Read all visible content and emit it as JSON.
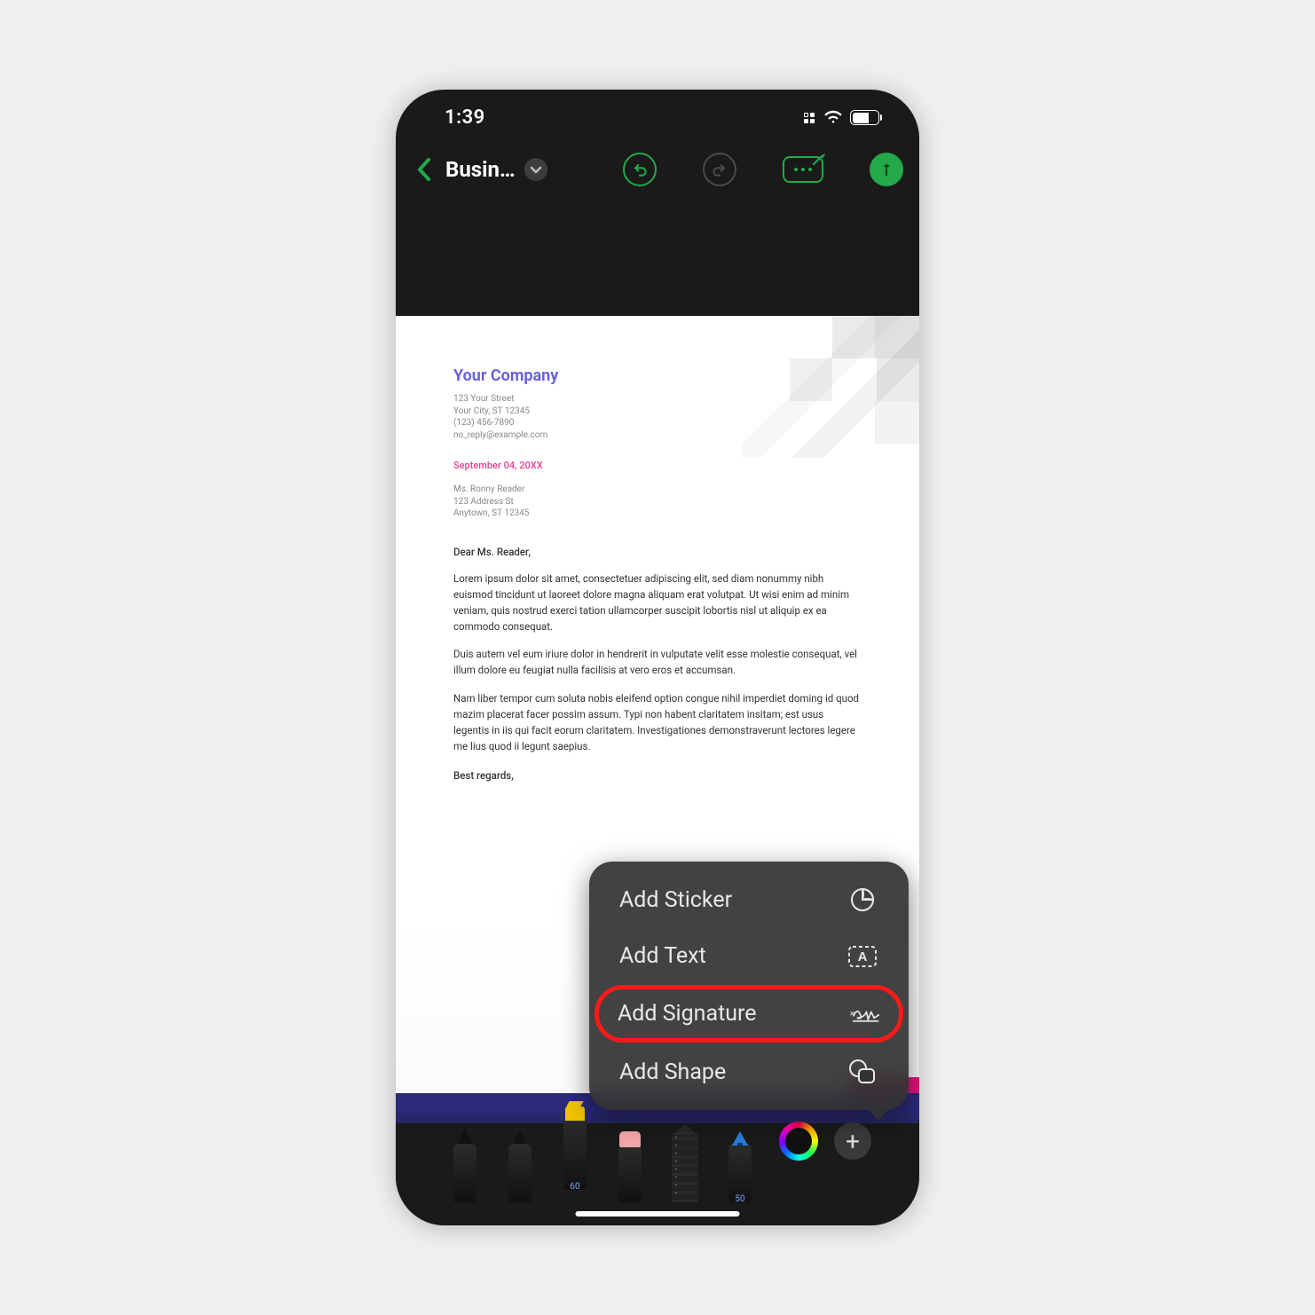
{
  "status": {
    "time": "1:39",
    "battery_pct": "63"
  },
  "nav": {
    "title": "Busin…"
  },
  "document": {
    "company": "Your Company",
    "address": {
      "line1": "123 Your Street",
      "line2": "Your City, ST 12345",
      "line3": "(123) 456-7890",
      "line4": "no_reply@example.com"
    },
    "date": "September 04, 20XX",
    "recipient": {
      "line1": "Ms. Ronny Reader",
      "line2": "123 Address St",
      "line3": "Anytown, ST 12345"
    },
    "salutation": "Dear Ms. Reader,",
    "para1": "Lorem ipsum dolor sit amet, consectetuer adipiscing elit, sed diam nonummy nibh euismod tincidunt ut laoreet dolore magna aliquam erat volutpat. Ut wisi enim ad minim veniam, quis nostrud exerci tation ullamcorper suscipit lobortis nisl ut aliquip ex ea commodo consequat.",
    "para2": "Duis autem vel eum iriure dolor in hendrerit in vulputate velit esse molestie consequat, vel illum dolore eu feugiat nulla facilisis at vero eros et accumsan.",
    "para3": "Nam liber tempor cum soluta nobis eleifend option congue nihil imperdiet doming id quod mazim placerat facer possim assum. Typi non habent claritatem insitam; est usus legentis in iis qui facit eorum claritatem. Investigationes demonstraverunt lectores legere me lius quod ii legunt saepius.",
    "closing": "Best regards,"
  },
  "popup": {
    "items": [
      {
        "label": "Add Sticker",
        "icon": "sticker-icon",
        "highlight": false
      },
      {
        "label": "Add Text",
        "icon": "text-box-icon",
        "highlight": false
      },
      {
        "label": "Add Signature",
        "icon": "signature-icon",
        "highlight": true
      },
      {
        "label": "Add Shape",
        "icon": "shape-icon",
        "highlight": false
      }
    ]
  },
  "tools": {
    "items": [
      {
        "name": "brush-tool",
        "label": ""
      },
      {
        "name": "fine-pen-tool",
        "label": ""
      },
      {
        "name": "highlighter-tool",
        "label": "60"
      },
      {
        "name": "eraser-tool",
        "label": ""
      },
      {
        "name": "ruler-tool",
        "label": ""
      },
      {
        "name": "pencil-tool",
        "label": "50"
      }
    ]
  }
}
